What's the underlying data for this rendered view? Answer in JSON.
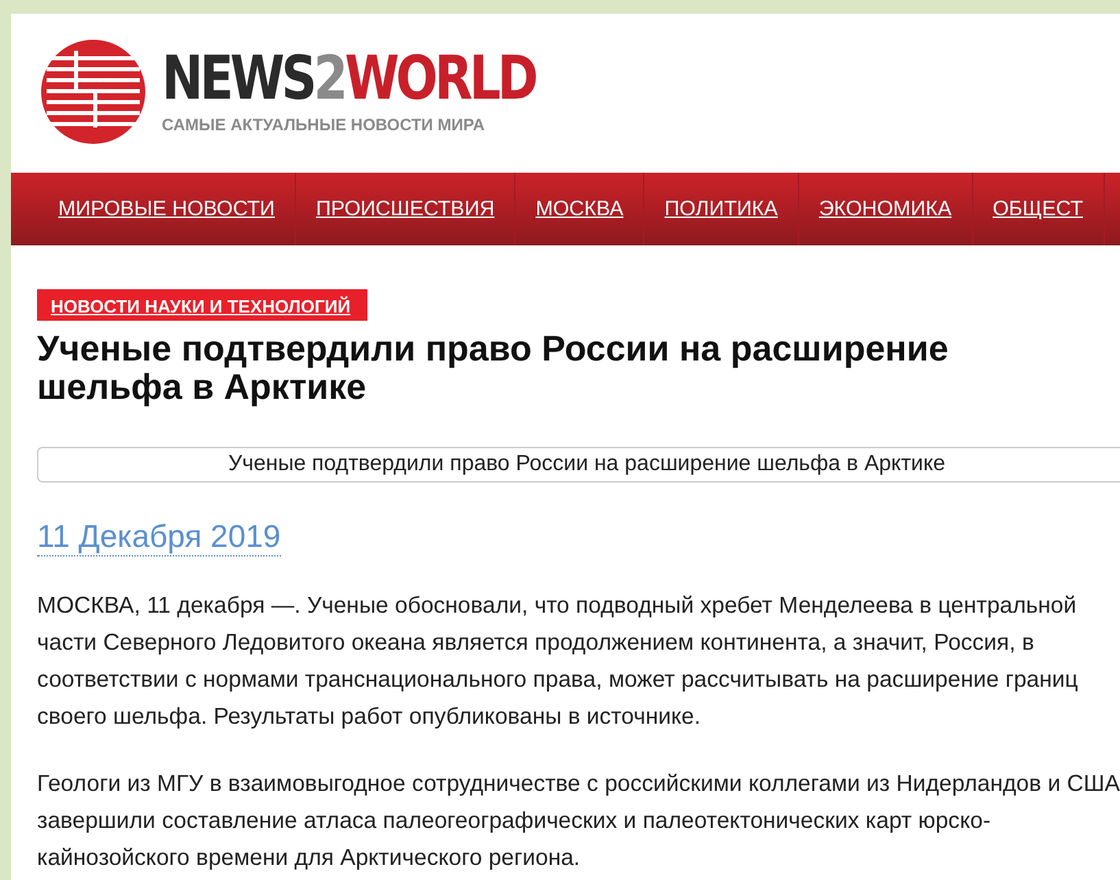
{
  "logo": {
    "parts": [
      {
        "text": "NEWS",
        "color": "#2b2b2b"
      },
      {
        "text": "2",
        "color": "#8a8a8a"
      },
      {
        "text": "WORLD",
        "color": "#c8202a"
      }
    ],
    "tagline": "САМЫЕ АКТУАЛЬНЫЕ НОВОСТИ МИРА"
  },
  "nav": [
    "МИРОВЫЕ НОВОСТИ",
    "ПРОИСШЕСТВИЯ",
    "МОСКВА",
    "ПОЛИТИКА",
    "ЭКОНОМИКА",
    "ОБЩЕСТ"
  ],
  "article": {
    "category": "НОВОСТИ НАУКИ И ТЕХНОЛОГИЙ",
    "title": "Ученые подтвердили право России на расширение шельфа в Арктике",
    "caption": "Ученые подтвердили право России на расширение шельфа в Арктике",
    "date": "11 Декабря 2019",
    "paragraphs": [
      "МОСКВА, 11 декабря —. Ученые обосновали, что подводный хребет Менделеева в центральной части Северного Ледовитого океана является продолжением континента, а значит, Россия, в соответствии с нормами транснационального права, может рассчитывать на расширение границ своего шельфа. Результаты работ опубликованы в источнике.",
      "Геологи из МГУ в взаимовыгодное сотрудничестве с российскими коллегами из Нидерландов и США завершили составление атласа палеогеографических и палеотектонических карт юрско-кайнозойского времени для Арктического региона."
    ]
  }
}
